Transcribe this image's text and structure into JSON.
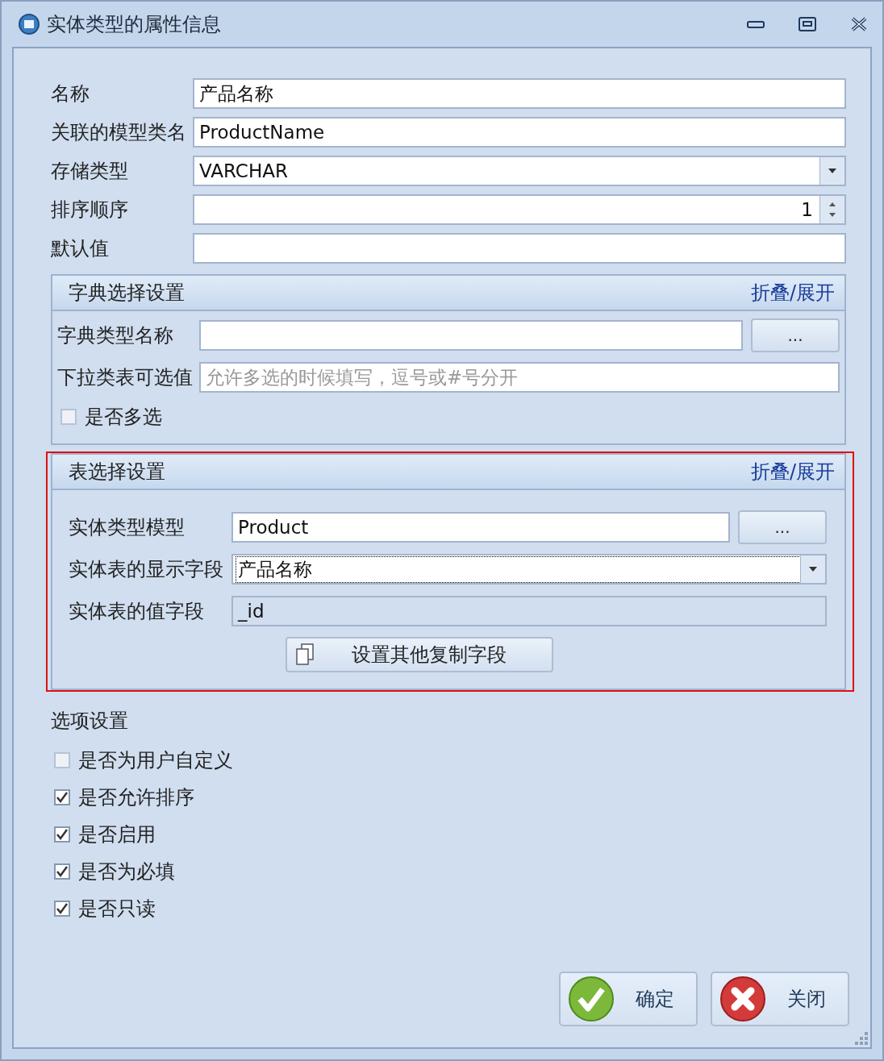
{
  "window": {
    "title": "实体类型的属性信息"
  },
  "fields": [
    {
      "label": "名称",
      "kind": "text",
      "value": "产品名称"
    },
    {
      "label": "关联的模型类名",
      "kind": "text",
      "value": "ProductName"
    },
    {
      "label": "存储类型",
      "kind": "combo",
      "value": "VARCHAR"
    },
    {
      "label": "排序顺序",
      "kind": "spin",
      "value": "1"
    },
    {
      "label": "默认值",
      "kind": "text"
    }
  ],
  "dictionary_section": {
    "title": "字典选择设置",
    "toggle": "折叠/展开",
    "highlighted": false,
    "fields": [
      {
        "label": "字典类型名称",
        "kind": "browse",
        "button": "..."
      },
      {
        "label": "下拉类表可选值",
        "kind": "text",
        "placeholder": "允许多选的时候填写，逗号或#号分开"
      }
    ],
    "checkbox": {
      "label": "是否多选",
      "checked": false
    }
  },
  "table_section": {
    "title": "表选择设置",
    "toggle": "折叠/展开",
    "highlighted": true,
    "fields": [
      {
        "label": "实体类型模型",
        "kind": "browse",
        "value": "Product",
        "button": "..."
      },
      {
        "label": "实体表的显示字段",
        "kind": "combo",
        "value": "产品名称",
        "focused": true
      },
      {
        "label": "实体表的值字段",
        "kind": "text",
        "value": "_id",
        "readonly": true
      }
    ],
    "action_button": "设置其他复制字段"
  },
  "options": {
    "title": "选项设置",
    "checkboxes": [
      {
        "label": "是否为用户自定义",
        "checked": false
      },
      {
        "label": "是否允许排序",
        "checked": true
      },
      {
        "label": "是否启用",
        "checked": true
      },
      {
        "label": "是否为必填",
        "checked": true
      },
      {
        "label": "是否只读",
        "checked": true
      }
    ]
  },
  "buttons": [
    {
      "label": "确定",
      "kind": "ok"
    },
    {
      "label": "关闭",
      "kind": "close"
    }
  ]
}
